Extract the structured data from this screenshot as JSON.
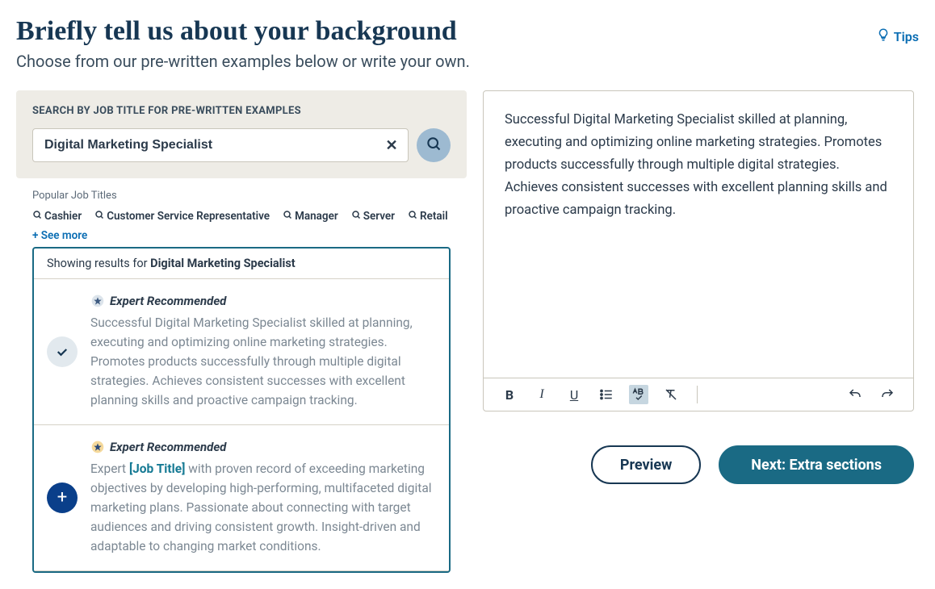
{
  "header": {
    "title": "Briefly tell us about your background",
    "subtitle": "Choose from our pre-written examples below or write your own.",
    "tips_label": "Tips"
  },
  "search": {
    "label": "SEARCH BY JOB TITLE FOR PRE-WRITTEN EXAMPLES",
    "value": "Digital Marketing Specialist"
  },
  "popular": {
    "title": "Popular Job Titles",
    "items": [
      "Cashier",
      "Customer Service Representative",
      "Manager",
      "Server",
      "Retail"
    ],
    "see_more": "+ See more"
  },
  "results": {
    "header_prefix": "Showing results for ",
    "header_term": "Digital Marketing Specialist",
    "expert_label": "Expert Recommended",
    "items": [
      {
        "selected": true,
        "star_color": "#a7b7c7",
        "body_plain": "Successful Digital Marketing Specialist skilled at planning, executing and optimizing online marketing strategies. Promotes products successfully through multiple digital strategies. Achieves consistent successes with excellent planning skills and proactive campaign tracking."
      },
      {
        "selected": false,
        "star_color": "#e6a23c",
        "body_prefix": "Expert ",
        "body_placeholder": "[Job Title]",
        "body_suffix": " with proven record of exceeding marketing objectives by developing high-performing, multifaceted digital marketing plans. Passionate about connecting with target audiences and driving consistent growth. Insight-driven and adaptable to changing market conditions."
      }
    ]
  },
  "editor": {
    "content": "Successful Digital Marketing Specialist skilled at planning, executing and optimizing online marketing strategies. Promotes products successfully through multiple digital strategies. Achieves consistent successes with excellent planning skills and proactive campaign tracking."
  },
  "actions": {
    "preview": "Preview",
    "next": "Next: Extra sections"
  }
}
